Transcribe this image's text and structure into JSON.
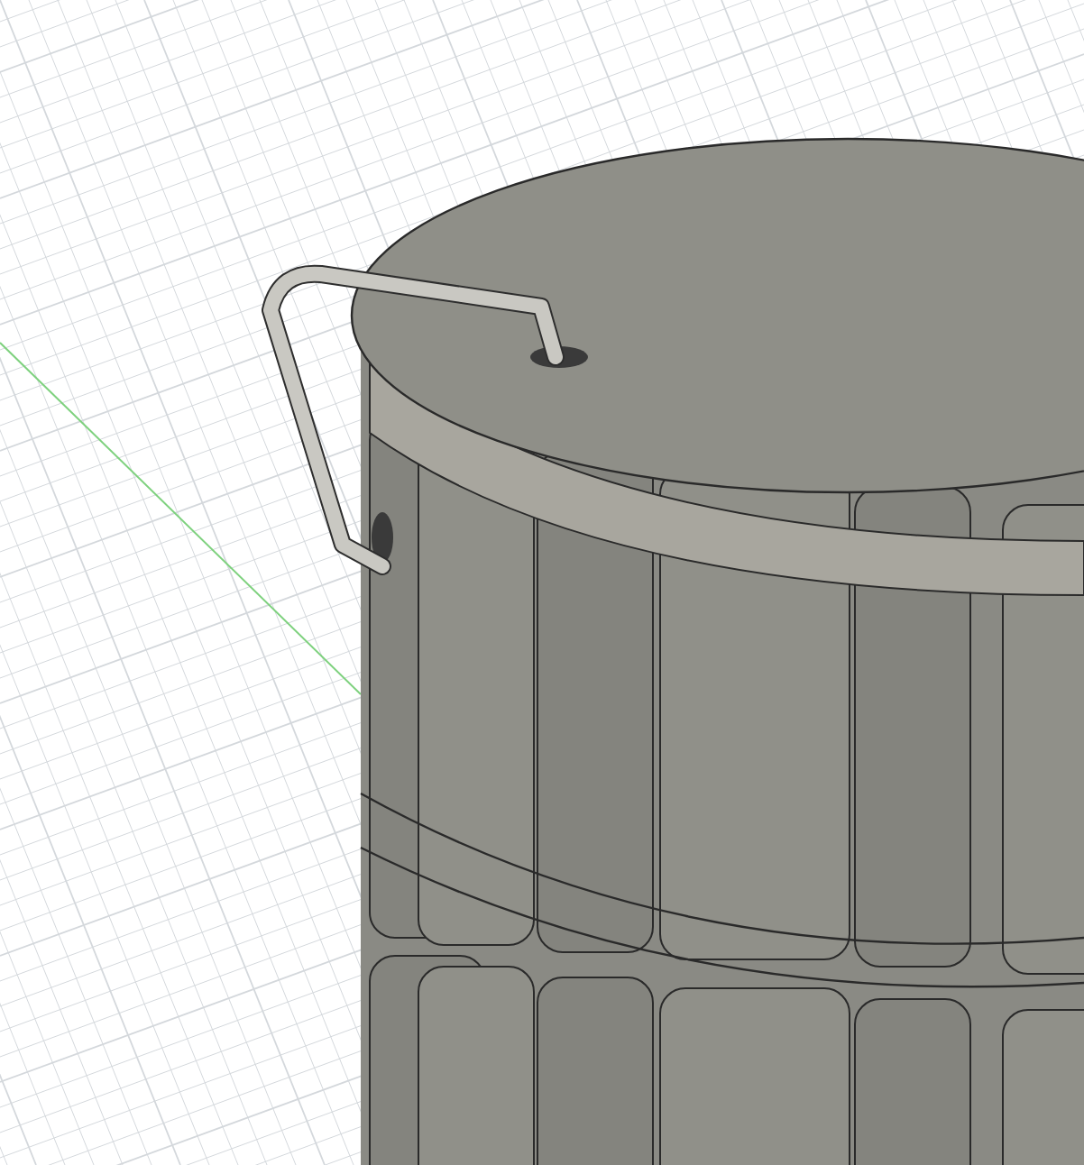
{
  "viewport": {
    "show_grid": true,
    "show_axis": true,
    "model": {
      "kind": "fluted-cylinder"
    }
  }
}
